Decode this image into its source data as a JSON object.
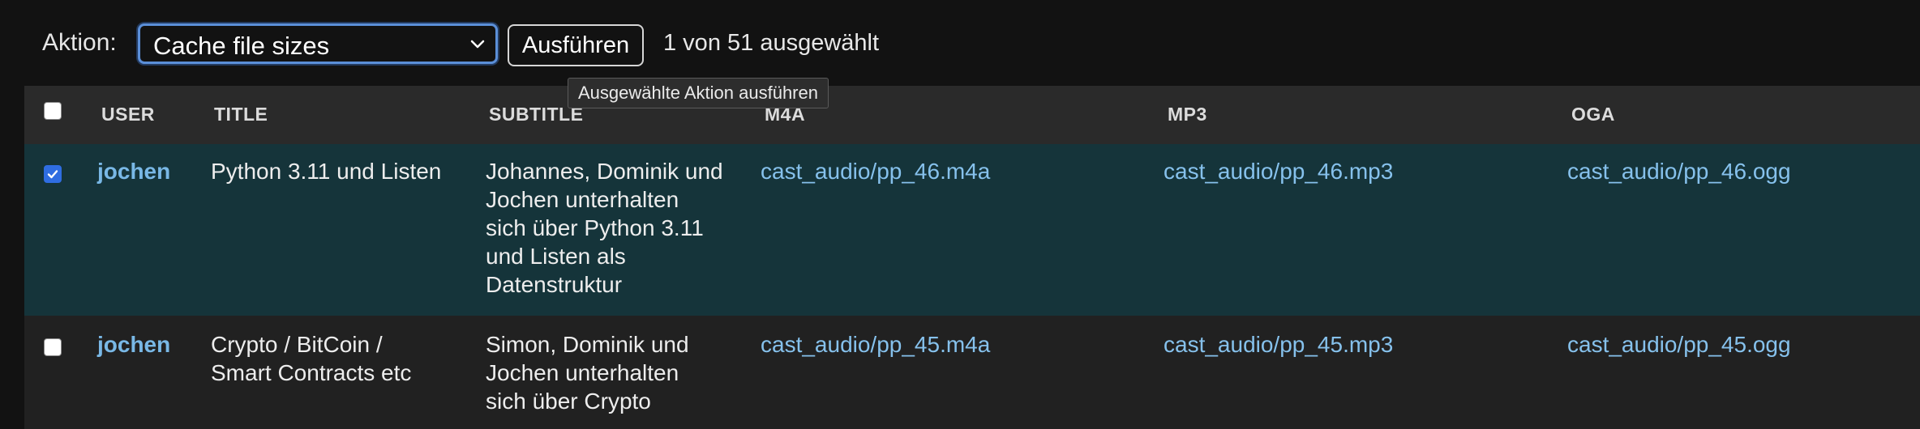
{
  "actions": {
    "label": "Aktion:",
    "selected_action": "Cache file sizes",
    "go_button": "Ausführen",
    "counter": "1 von 51 ausgewählt",
    "tooltip": "Ausgewählte Aktion ausführen"
  },
  "table": {
    "columns": [
      "USER",
      "TITLE",
      "SUBTITLE",
      "M4A",
      "MP3",
      "OGA"
    ],
    "rows": [
      {
        "checked": true,
        "user": "jochen",
        "title": [
          "Python 3.11 und Listen"
        ],
        "subtitle": [
          "Johannes, Dominik und",
          "Jochen unterhalten",
          "sich über Python 3.11",
          "und Listen als",
          "Datenstruktur"
        ],
        "m4a": "cast_audio/pp_46.m4a",
        "mp3": "cast_audio/pp_46.mp3",
        "oga": "cast_audio/pp_46.ogg"
      },
      {
        "checked": false,
        "user": "jochen",
        "title": [
          "Crypto / BitCoin /",
          "Smart Contracts etc"
        ],
        "subtitle": [
          "Simon, Dominik und",
          "Jochen unterhalten",
          "sich über Crypto"
        ],
        "m4a": "cast_audio/pp_45.m4a",
        "mp3": "cast_audio/pp_45.mp3",
        "oga": "cast_audio/pp_45.ogg"
      }
    ]
  },
  "colors": {
    "background": "#121212",
    "table_background": "#212121",
    "header_background": "#2a2a2a",
    "selected_row": "#15343a",
    "link": "#86c1ec",
    "user_link": "#79b8e6",
    "checkbox_checked": "#2f6de1",
    "focus_ring": "#5b8fd8"
  },
  "icons": {
    "select_indicator": "chevron-down-icon",
    "checked_mark": "checkmark-icon"
  }
}
